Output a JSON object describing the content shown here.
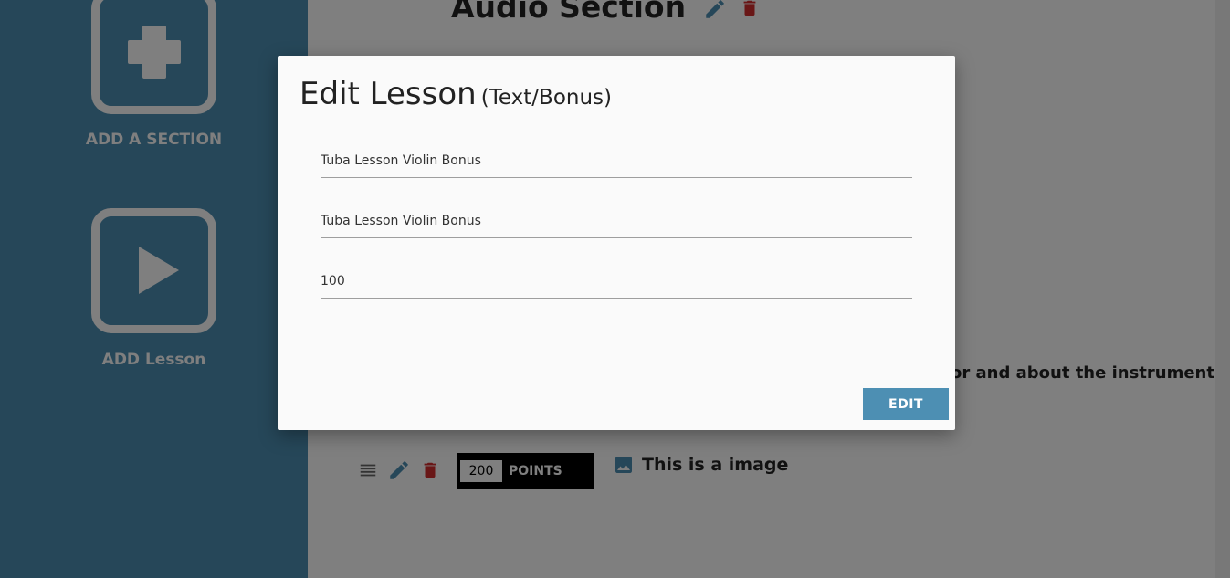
{
  "sidebar": {
    "add_section_label": "ADD A SECTION",
    "add_lesson_label": "ADD Lesson"
  },
  "main": {
    "section_title": "Audio Section",
    "description_fragment": "or and about the instrument",
    "lesson_row": {
      "points_value": "200",
      "points_label": "POINTS",
      "lesson_text": "This is a image"
    }
  },
  "modal": {
    "title": "Edit Lesson",
    "subtitle": "(Text/Bonus)",
    "fields": [
      {
        "value": "Tuba Lesson Violin Bonus"
      },
      {
        "value": "Tuba Lesson Violin Bonus"
      },
      {
        "value": "100"
      }
    ],
    "submit_label": "EDIT"
  },
  "colors": {
    "accent": "#4d8fb3",
    "delete": "#d32f2f",
    "overlay": "rgba(0,0,0,0.5)"
  }
}
